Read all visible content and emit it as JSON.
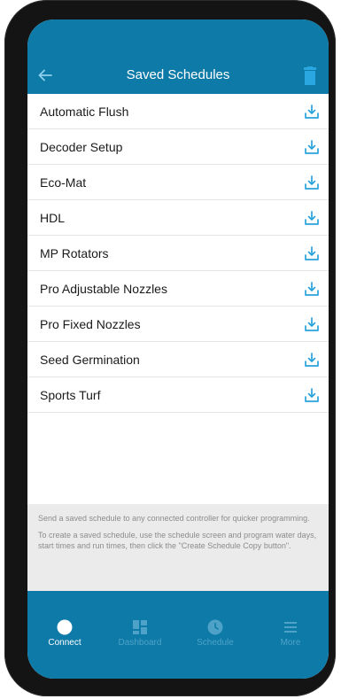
{
  "colors": {
    "brand": "#0d7aa8",
    "accent_icon": "#27a3dc",
    "inactive_tab": "#4fa2c7",
    "info_bg": "#ebebeb"
  },
  "header": {
    "title": "Saved Schedules",
    "back_icon": "arrow-left-icon",
    "trash_icon": "trash-icon"
  },
  "schedules": [
    {
      "label": "Automatic Flush"
    },
    {
      "label": "Decoder Setup"
    },
    {
      "label": "Eco-Mat"
    },
    {
      "label": "HDL"
    },
    {
      "label": "MP Rotators"
    },
    {
      "label": "Pro Adjustable Nozzles"
    },
    {
      "label": "Pro Fixed Nozzles"
    },
    {
      "label": "Seed Germination"
    },
    {
      "label": "Sports Turf"
    }
  ],
  "info": {
    "line1": "Send a saved schedule to any connected controller for quicker programming.",
    "line2": "To create a saved schedule, use the schedule screen and program water days, start times and run times, then click the \"Create Schedule Copy button\"."
  },
  "tabs": [
    {
      "label": "Connect",
      "icon": "connect-dot-icon",
      "active": true
    },
    {
      "label": "Dashboard",
      "icon": "dashboard-icon",
      "active": false
    },
    {
      "label": "Schedule",
      "icon": "clock-icon",
      "active": false
    },
    {
      "label": "More",
      "icon": "menu-icon",
      "active": false
    }
  ]
}
